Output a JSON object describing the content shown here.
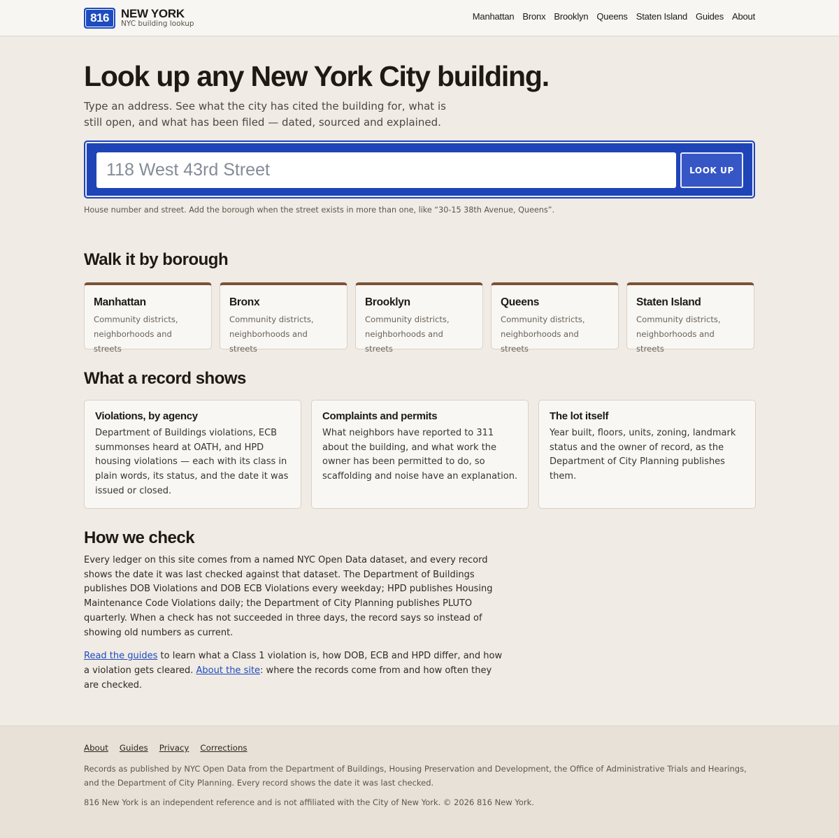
{
  "header": {
    "logo_text": "816",
    "brand_name": "NEW YORK",
    "brand_sub": "NYC building lookup",
    "nav": [
      "Manhattan",
      "Bronx",
      "Brooklyn",
      "Queens",
      "Staten Island",
      "Guides",
      "About"
    ]
  },
  "hero": {
    "title": "Look up any New York City building.",
    "subtitle": "Type an address. See what the city has cited the building for, what is still open, and what has been filed — dated, sourced and explained.",
    "search_placeholder": "118 West 43rd Street",
    "search_button": "LOOK UP",
    "hint": "House number and street. Add the borough when the street exists in more than one, like “30-15 38th Avenue, Queens”."
  },
  "boroughs_section": {
    "title": "Walk it by borough",
    "cards": [
      {
        "name": "Manhattan",
        "desc": "Community districts, neighborhoods and streets"
      },
      {
        "name": "Bronx",
        "desc": "Community districts, neighborhoods and streets"
      },
      {
        "name": "Brooklyn",
        "desc": "Community districts, neighborhoods and streets"
      },
      {
        "name": "Queens",
        "desc": "Community districts, neighborhoods and streets"
      },
      {
        "name": "Staten Island",
        "desc": "Community districts, neighborhoods and streets"
      }
    ]
  },
  "records_section": {
    "title": "What a record shows",
    "cards": [
      {
        "title": "Violations, by agency",
        "desc": "Department of Buildings violations, ECB summonses heard at OATH, and HPD housing violations — each with its class in plain words, its status, and the date it was issued or closed."
      },
      {
        "title": "Complaints and permits",
        "desc": "What neighbors have reported to 311 about the building, and what work the owner has been permitted to do, so scaffolding and noise have an explanation."
      },
      {
        "title": "The lot itself",
        "desc": "Year built, floors, units, zoning, landmark status and the owner of record, as the Department of City Planning publishes them."
      }
    ]
  },
  "check_section": {
    "title": "How we check",
    "para1": "Every ledger on this site comes from a named NYC Open Data dataset, and every record shows the date it was last checked against that dataset. The Department of Buildings publishes DOB Violations and DOB ECB Violations every weekday; HPD publishes Housing Maintenance Code Violations daily; the Department of City Planning publishes PLUTO quarterly. When a check has not succeeded in three days, the record says so instead of showing old numbers as current.",
    "link1": "Read the guides",
    "text1": " to learn what a Class 1 violation is, how DOB, ECB and HPD differ, and how a violation gets cleared. ",
    "link2": "About the site",
    "text2": ": where the records come from and how often they are checked."
  },
  "footer": {
    "links": [
      "About",
      "Guides",
      "Privacy",
      "Corrections"
    ],
    "para1": "Records as published by NYC Open Data from the Department of Buildings, Housing Preservation and Development, the Office of Administrative Trials and Hearings, and the Department of City Planning. Every record shows the date it was last checked.",
    "para2": "816 New York is an independent reference and is not affiliated with the City of New York. © 2026 816 New York."
  },
  "colors": {
    "accent_blue": "#1e44b8",
    "card_border_top": "#7a5236",
    "background": "#f0ebe4"
  }
}
